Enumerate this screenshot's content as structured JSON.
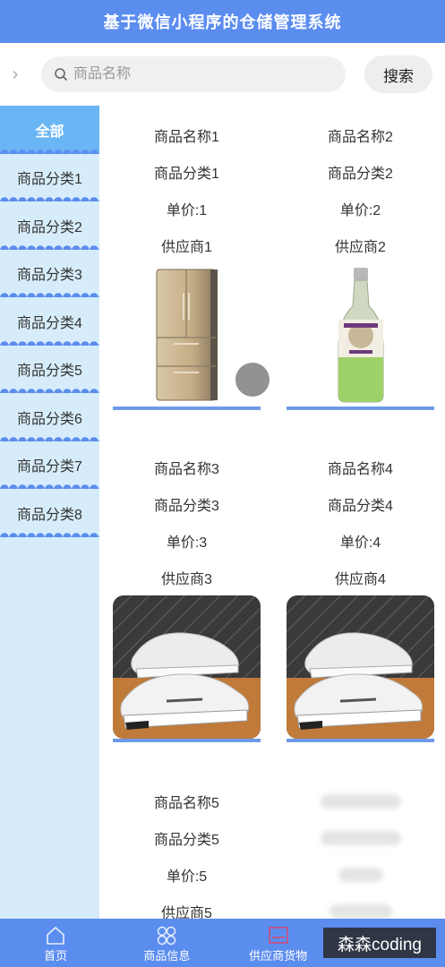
{
  "header": {
    "title": "基于微信小程序的仓储管理系统"
  },
  "search": {
    "placeholder": "商品名称",
    "button": "搜索"
  },
  "sidebar": {
    "items": [
      {
        "label": "全部",
        "active": true
      },
      {
        "label": "商品分类1"
      },
      {
        "label": "商品分类2"
      },
      {
        "label": "商品分类3"
      },
      {
        "label": "商品分类4"
      },
      {
        "label": "商品分类5"
      },
      {
        "label": "商品分类6"
      },
      {
        "label": "商品分类7"
      },
      {
        "label": "商品分类8"
      }
    ]
  },
  "products": [
    {
      "name": "商品名称1",
      "category": "商品分类1",
      "price": "单价:1",
      "supplier": "供应商1",
      "image": "refrigerator-image"
    },
    {
      "name": "商品名称2",
      "category": "商品分类2",
      "price": "单价:2",
      "supplier": "供应商2",
      "image": "bottle-image"
    },
    {
      "name": "商品名称3",
      "category": "商品分类3",
      "price": "单价:3",
      "supplier": "供应商3",
      "image": "sneaker-image"
    },
    {
      "name": "商品名称4",
      "category": "商品分类4",
      "price": "单价:4",
      "supplier": "供应商4",
      "image": "sneaker-image"
    },
    {
      "name": "商品名称5",
      "category": "商品分类5",
      "price": "单价:5",
      "supplier": "供应商5",
      "image": "none"
    }
  ],
  "tabbar": {
    "items": [
      {
        "label": "首页",
        "icon": "home-icon"
      },
      {
        "label": "商品信息",
        "icon": "grid-icon"
      },
      {
        "label": "供应商货物",
        "icon": "box-icon"
      },
      {
        "label": "",
        "icon": ""
      }
    ]
  },
  "watermark": "森森coding",
  "colors": {
    "primary": "#5b8def",
    "sidebar_bg": "#d7ecfa",
    "active_cat": "#6ab6f5"
  }
}
